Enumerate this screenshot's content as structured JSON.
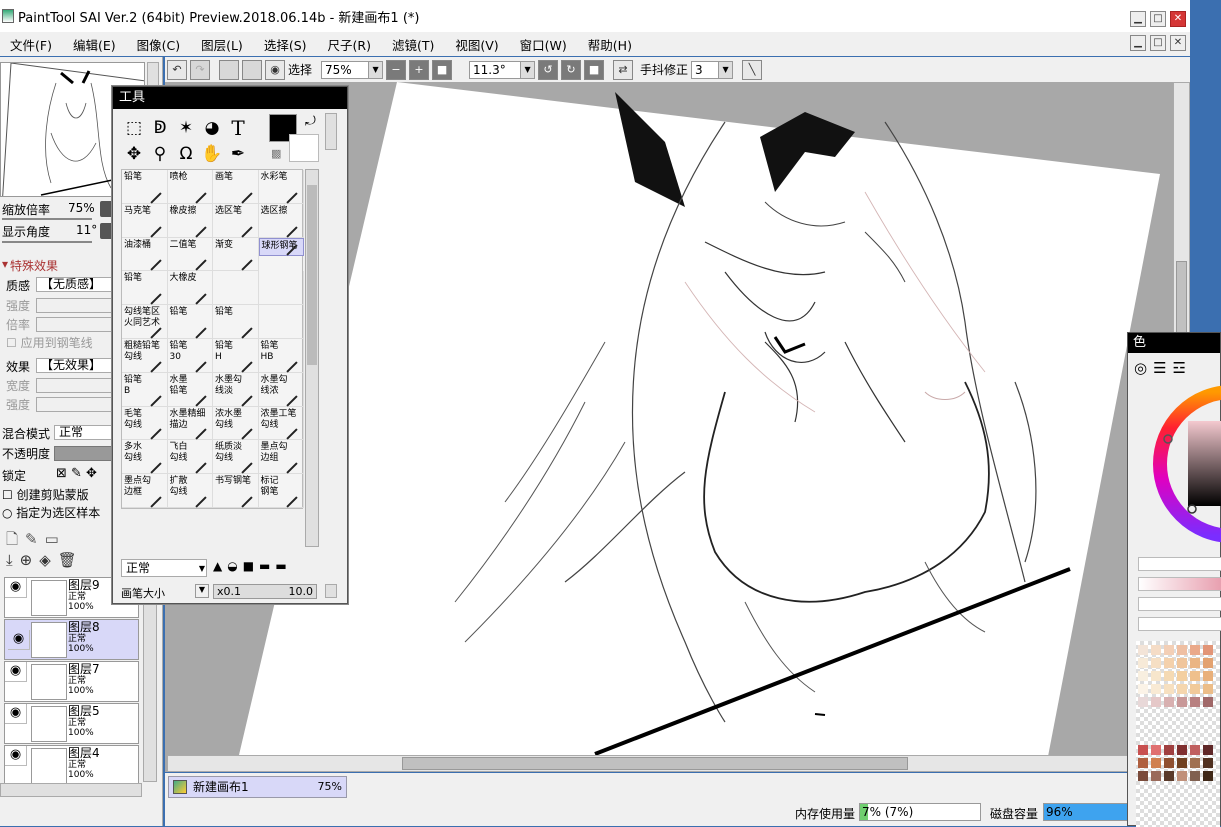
{
  "window": {
    "title": "PaintTool SAI Ver.2 (64bit) Preview.2018.06.14b - 新建画布1 (*)",
    "min": "▁",
    "max": "□",
    "close": "✕"
  },
  "menu": [
    "文件(F)",
    "编辑(E)",
    "图像(C)",
    "图层(L)",
    "选择(S)",
    "尺子(R)",
    "滤镜(T)",
    "视图(V)",
    "窗口(W)",
    "帮助(H)"
  ],
  "toolbar": {
    "select_label": "选择",
    "zoom": "75%",
    "angle": "11.3°",
    "stabilizer_label": "手抖修正",
    "stabilizer_value": "3"
  },
  "navigator": {
    "zoom_label": "缩放倍率",
    "zoom_value": "75%",
    "angle_label": "显示角度",
    "angle_value": "11°"
  },
  "effects": {
    "section_title": "特殊效果",
    "texture_label": "质感",
    "texture_value": "【无质感】",
    "strength_label": "强度",
    "scale_label": "倍率",
    "apply_pen": "应用到钢笔线",
    "effect_label": "效果",
    "effect_value": "【无效果】",
    "width_label": "宽度",
    "strength2_label": "强度"
  },
  "layer_props": {
    "blend_label": "混合模式",
    "blend_value": "正常",
    "opacity_label": "不透明度",
    "lock_label": "锁定",
    "clip_label": "创建剪贴蒙版",
    "sample_label": "指定为选区样本"
  },
  "layers": [
    {
      "name": "图层9",
      "mode": "正常",
      "opacity": "100%",
      "selected": false
    },
    {
      "name": "图层8",
      "mode": "正常",
      "opacity": "100%",
      "selected": true
    },
    {
      "name": "图层7",
      "mode": "正常",
      "opacity": "100%",
      "selected": false
    },
    {
      "name": "图层5",
      "mode": "正常",
      "opacity": "100%",
      "selected": false
    },
    {
      "name": "图层4",
      "mode": "正常",
      "opacity": "100%",
      "selected": false
    }
  ],
  "tools_window": {
    "title": "工具",
    "text_tool": "T",
    "brushes": [
      {
        "l1": "铅笔",
        "l2": ""
      },
      {
        "l1": "喷枪",
        "l2": ""
      },
      {
        "l1": "画笔",
        "l2": ""
      },
      {
        "l1": "水彩笔",
        "l2": ""
      },
      {
        "l1": "马克笔",
        "l2": ""
      },
      {
        "l1": "橡皮擦",
        "l2": ""
      },
      {
        "l1": "选区笔",
        "l2": ""
      },
      {
        "l1": "选区擦",
        "l2": ""
      },
      {
        "l1": "油漆桶",
        "l2": ""
      },
      {
        "l1": "二值笔",
        "l2": ""
      },
      {
        "l1": "渐变",
        "l2": ""
      },
      {
        "l1": "球形钢笔",
        "l2": ""
      },
      {
        "l1": "铅笔",
        "l2": ""
      },
      {
        "l1": "大橡皮",
        "l2": ""
      },
      {
        "l1": "",
        "l2": ""
      },
      {
        "l1": "",
        "l2": ""
      },
      {
        "l1": "勾线笔区",
        "l2": "火同艺术"
      },
      {
        "l1": "铅笔",
        "l2": ""
      },
      {
        "l1": "铅笔",
        "l2": ""
      },
      {
        "l1": "",
        "l2": ""
      },
      {
        "l1": "粗糙铅笔",
        "l2": "勾线"
      },
      {
        "l1": "铅笔",
        "l2": "30"
      },
      {
        "l1": "铅笔",
        "l2": "H"
      },
      {
        "l1": "铅笔",
        "l2": "HB"
      },
      {
        "l1": "铅笔",
        "l2": "B"
      },
      {
        "l1": "水墨",
        "l2": "铅笔"
      },
      {
        "l1": "水墨勾",
        "l2": "线淡"
      },
      {
        "l1": "水墨勾",
        "l2": "线浓"
      },
      {
        "l1": "毛笔",
        "l2": "勾线"
      },
      {
        "l1": "水墨精细",
        "l2": "描边"
      },
      {
        "l1": "浓水墨",
        "l2": "勾线"
      },
      {
        "l1": "浓墨工笔",
        "l2": "勾线"
      },
      {
        "l1": "多水",
        "l2": "勾线"
      },
      {
        "l1": "飞白",
        "l2": "勾线"
      },
      {
        "l1": "纸质淡",
        "l2": "勾线"
      },
      {
        "l1": "墨点勾",
        "l2": "边组"
      },
      {
        "l1": "墨点勾",
        "l2": "边框"
      },
      {
        "l1": "扩散",
        "l2": "勾线"
      },
      {
        "l1": "书写钢笔",
        "l2": ""
      },
      {
        "l1": "标记",
        "l2": "钢笔"
      }
    ],
    "blend_mode": "正常",
    "brush_size_label": "画笔大小",
    "size_multiplier": "x0.1",
    "size_value": "10.0"
  },
  "color_window": {
    "title": "色",
    "palette": [
      "#f3e4d8",
      "#f5dcc6",
      "#f3cfb6",
      "#efbfa2",
      "#eaa98a",
      "#e29577",
      "#f7ead8",
      "#f6dfc4",
      "#f4d1ac",
      "#f0c59b",
      "#eab584",
      "#e3a270",
      "#f8efe0",
      "#f7e6cc",
      "#f5dab4",
      "#f3cfa0",
      "#efc08c",
      "#e9b07a",
      "#fbf3e7",
      "#f9ead4",
      "#f7e0c0",
      "#f5d6ae",
      "#f1ca9a",
      "#ecbd88",
      "#e8d8d8",
      "#e5c8c8",
      "#d8b0b0",
      "#c89898",
      "#b88080",
      "#a06868"
    ],
    "palette2": [
      "#c85050",
      "#e07070",
      "#a04040",
      "#803030",
      "#c06060",
      "#602828",
      "#b06040",
      "#d08050",
      "#905030",
      "#704020",
      "#a07050",
      "#503020",
      "#7a4a3a",
      "#9a6a5a",
      "#5a3a2a",
      "#c0907a",
      "#806050",
      "#402818"
    ],
    "accent_ring": "#ff3c3c"
  },
  "document": {
    "tab_name": "新建画布1",
    "tab_zoom": "75%"
  },
  "status": {
    "memory_label": "内存使用量",
    "memory_value": "7% (7%)",
    "memory_fraction": 0.07,
    "disk_label": "磁盘容量",
    "disk_value": "96%",
    "disk_fraction": 0.96
  }
}
